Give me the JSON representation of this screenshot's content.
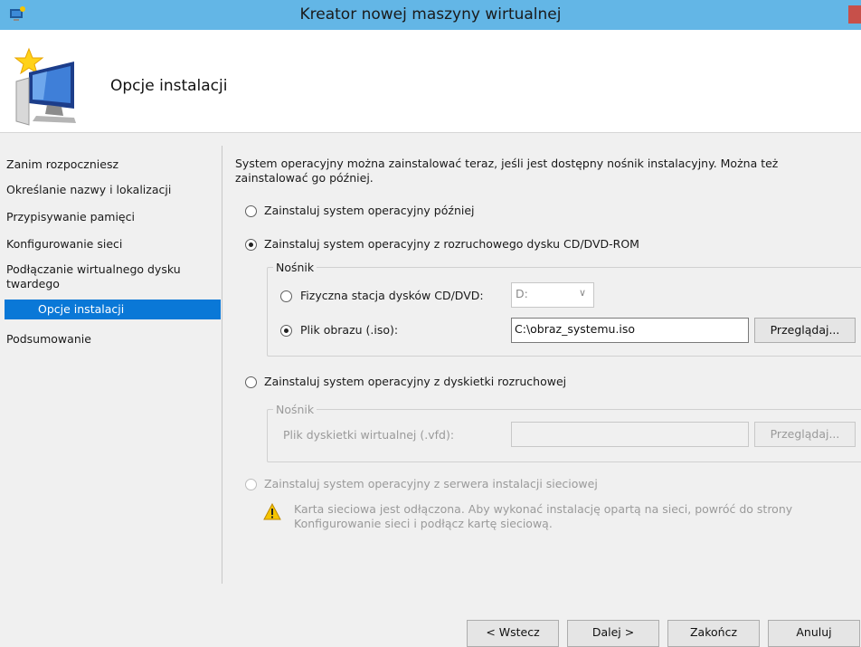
{
  "window": {
    "title": "Kreator nowej maszyny wirtualnej"
  },
  "header": {
    "title": "Opcje instalacji"
  },
  "nav": {
    "items": [
      {
        "label": "Zanim rozpoczniesz"
      },
      {
        "label": "Określanie nazwy i lokalizacji"
      },
      {
        "label": "Przypisywanie pamięci"
      },
      {
        "label": "Konfigurowanie sieci"
      },
      {
        "label": "Podłączanie wirtualnego dysku twardego"
      },
      {
        "label": "Opcje instalacji",
        "active": true
      },
      {
        "label": "Podsumowanie"
      }
    ]
  },
  "intro": "System operacyjny można zainstalować teraz, jeśli jest dostępny nośnik instalacyjny. Można też zainstalować go później.",
  "options": {
    "later": {
      "label": "Zainstaluj system operacyjny później",
      "selected": false
    },
    "cd": {
      "label": "Zainstaluj system operacyjny z rozruchowego dysku CD/DVD-ROM",
      "selected": true,
      "group_label": "Nośnik",
      "physical": {
        "label": "Fizyczna stacja dysków CD/DVD:",
        "selected": false,
        "drive": "D:"
      },
      "image": {
        "label": "Plik obrazu (.iso):",
        "selected": true,
        "path": "C:\\obraz_systemu.iso",
        "browse": "Przeglądaj..."
      }
    },
    "floppy": {
      "label": "Zainstaluj system operacyjny z dyskietki rozruchowej",
      "selected": false,
      "group_label": "Nośnik",
      "file_label": "Plik dyskietki wirtualnej (.vfd):",
      "file_value": "",
      "browse": "Przeglądaj..."
    },
    "network": {
      "label": "Zainstaluj system operacyjny z serwera instalacji sieciowej",
      "selected": false,
      "enabled": false,
      "warning": "Karta sieciowa jest odłączona. Aby wykonać instalację opartą na sieci, powróć do strony Konfigurowanie sieci i podłącz kartę sieciową."
    }
  },
  "footer": {
    "back": "< Wstecz",
    "next": "Dalej >",
    "finish": "Zakończ",
    "cancel": "Anuluj"
  },
  "colors": {
    "titlebar": "#63b6e6",
    "nav_active": "#0a78d7",
    "close": "#c7504a"
  }
}
